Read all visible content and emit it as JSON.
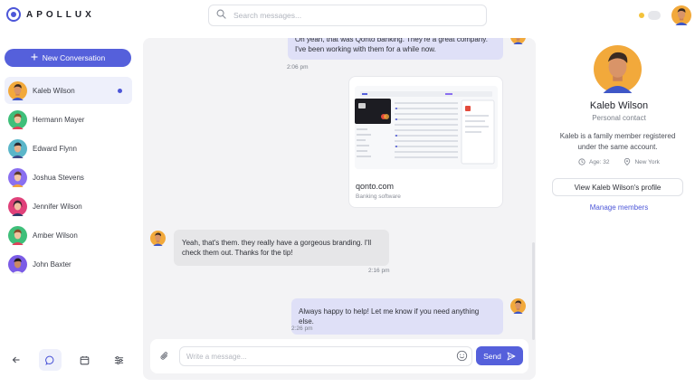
{
  "header": {
    "logo_text": "APOLLUX",
    "search_placeholder": "Search messages..."
  },
  "sidebar": {
    "new_conversation_label": "New Conversation",
    "contacts": [
      {
        "name": "Kaleb Wilson",
        "active": true,
        "unread": true
      },
      {
        "name": "Hermann Mayer"
      },
      {
        "name": "Edward Flynn"
      },
      {
        "name": "Joshua Stevens"
      },
      {
        "name": "Jennifer Wilson"
      },
      {
        "name": "Amber Wilson"
      },
      {
        "name": "John Baxter"
      }
    ],
    "nav_icons": [
      "back-arrow-icon",
      "chat-icon",
      "calendar-icon",
      "settings-sliders-icon"
    ]
  },
  "chat": {
    "messages": [
      {
        "direction": "outgoing",
        "text": "Oh yeah, that was Qonto banking. They're a great company. I've been working with them for a while now.",
        "time": "2:06 pm"
      },
      {
        "direction": "outgoing",
        "type": "link-preview",
        "title": "qonto.com",
        "subtitle": "Banking software"
      },
      {
        "direction": "incoming",
        "text": "Yeah, that's them. they really have a gorgeous branding. I'll check them out. Thanks for the tip!",
        "time": "2:16 pm"
      },
      {
        "direction": "outgoing",
        "text": "Always happy to help! Let me know if you need anything else.",
        "time": "2:26 pm"
      }
    ],
    "composer_placeholder": "Write a message...",
    "send_label": "Send"
  },
  "profile": {
    "name": "Kaleb Wilson",
    "role": "Personal contact",
    "description": "Kaleb is a family member registered under the same account.",
    "age": "Age: 32",
    "location": "New York",
    "view_profile_label": "View Kaleb Wilson's profile",
    "manage_label": "Manage members"
  },
  "colors": {
    "accent": "#5560db",
    "outgoing_bubble": "#dfe0f7",
    "incoming_bubble": "#e6e6e8",
    "chat_background": "#f3f3f5"
  }
}
